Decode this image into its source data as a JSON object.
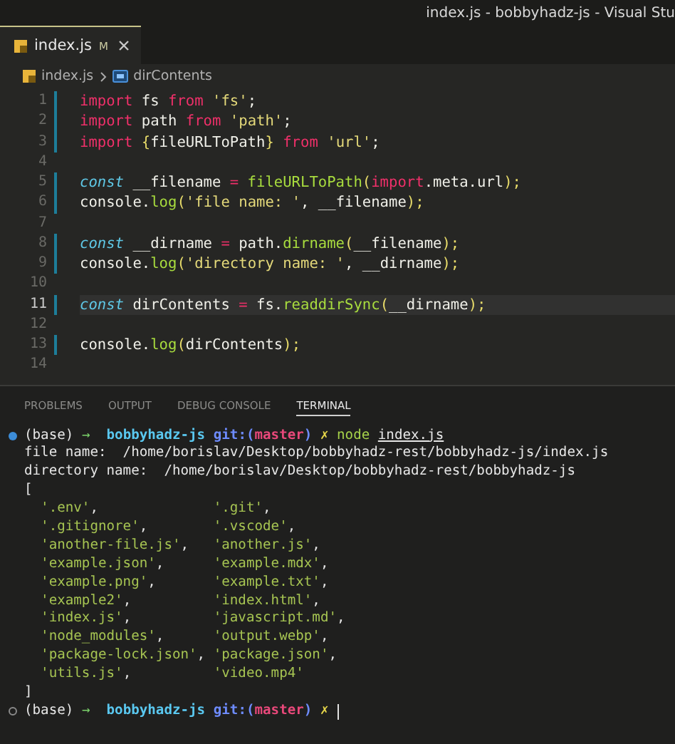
{
  "window": {
    "title": "index.js - bobbyhadz-js - Visual Stu"
  },
  "tabs": [
    {
      "label": "index.js",
      "modified": "M",
      "selected": true
    }
  ],
  "breadcrumb": {
    "file": "index.js",
    "symbol": "dirContents"
  },
  "code_lines": [
    {
      "number": "1",
      "changed": true,
      "current": false,
      "tokens": [
        {
          "text": "import",
          "kind": "keyword"
        },
        {
          "text": " fs ",
          "kind": "plain"
        },
        {
          "text": "from",
          "kind": "keyword"
        },
        {
          "text": " 'fs'",
          "kind": "string"
        },
        {
          "text": ";",
          "kind": "plain"
        }
      ]
    },
    {
      "number": "2",
      "changed": true,
      "current": false,
      "tokens": [
        {
          "text": "import",
          "kind": "keyword"
        },
        {
          "text": " path ",
          "kind": "plain"
        },
        {
          "text": "from",
          "kind": "keyword"
        },
        {
          "text": " 'path'",
          "kind": "string"
        },
        {
          "text": ";",
          "kind": "plain"
        }
      ]
    },
    {
      "number": "3",
      "changed": true,
      "current": false,
      "tokens": [
        {
          "text": "import",
          "kind": "keyword"
        },
        {
          "text": " {",
          "kind": "brace"
        },
        {
          "text": "fileURLToPath",
          "kind": "plain"
        },
        {
          "text": "} ",
          "kind": "brace"
        },
        {
          "text": "from",
          "kind": "keyword"
        },
        {
          "text": " 'url'",
          "kind": "string"
        },
        {
          "text": ";",
          "kind": "plain"
        }
      ]
    },
    {
      "number": "4",
      "changed": false,
      "current": false
    },
    {
      "number": "5",
      "changed": true,
      "current": false,
      "tokens": [
        {
          "text": "const",
          "kind": "storage"
        },
        {
          "text": " __filename ",
          "kind": "plain"
        },
        {
          "text": "=",
          "kind": "keyword"
        },
        {
          "text": " fileURLToPath",
          "kind": "function"
        },
        {
          "text": "(",
          "kind": "brace"
        },
        {
          "text": "import",
          "kind": "keyword"
        },
        {
          "text": ".meta.url",
          "kind": "plain"
        },
        {
          "text": ");",
          "kind": "brace"
        }
      ]
    },
    {
      "number": "6",
      "changed": true,
      "current": false,
      "tokens": [
        {
          "text": "console.",
          "kind": "plain"
        },
        {
          "text": "log",
          "kind": "function"
        },
        {
          "text": "(",
          "kind": "brace"
        },
        {
          "text": "'file name: '",
          "kind": "string"
        },
        {
          "text": ", __filename",
          "kind": "plain"
        },
        {
          "text": ");",
          "kind": "brace"
        }
      ]
    },
    {
      "number": "7",
      "changed": false,
      "current": false
    },
    {
      "number": "8",
      "changed": true,
      "current": false,
      "tokens": [
        {
          "text": "const",
          "kind": "storage"
        },
        {
          "text": " __dirname ",
          "kind": "plain"
        },
        {
          "text": "=",
          "kind": "keyword"
        },
        {
          "text": " path.",
          "kind": "plain"
        },
        {
          "text": "dirname",
          "kind": "function"
        },
        {
          "text": "(",
          "kind": "brace"
        },
        {
          "text": "__filename",
          "kind": "plain"
        },
        {
          "text": ");",
          "kind": "brace"
        }
      ]
    },
    {
      "number": "9",
      "changed": true,
      "current": false,
      "tokens": [
        {
          "text": "console.",
          "kind": "plain"
        },
        {
          "text": "log",
          "kind": "function"
        },
        {
          "text": "(",
          "kind": "brace"
        },
        {
          "text": "'directory name: '",
          "kind": "string"
        },
        {
          "text": ", __dirname",
          "kind": "plain"
        },
        {
          "text": ");",
          "kind": "brace"
        }
      ]
    },
    {
      "number": "10",
      "changed": false,
      "current": false
    },
    {
      "number": "11",
      "changed": true,
      "current": true,
      "tokens": [
        {
          "text": "const",
          "kind": "storage"
        },
        {
          "text": " dirContents ",
          "kind": "plain"
        },
        {
          "text": "=",
          "kind": "keyword"
        },
        {
          "text": " fs.",
          "kind": "plain"
        },
        {
          "text": "readdirSync",
          "kind": "function"
        },
        {
          "text": "(",
          "kind": "brace"
        },
        {
          "text": "__dirname",
          "kind": "plain"
        },
        {
          "text": ");",
          "kind": "brace"
        }
      ]
    },
    {
      "number": "12",
      "changed": false,
      "current": false
    },
    {
      "number": "13",
      "changed": true,
      "current": false,
      "tokens": [
        {
          "text": "console.",
          "kind": "plain"
        },
        {
          "text": "log",
          "kind": "function"
        },
        {
          "text": "(",
          "kind": "brace"
        },
        {
          "text": "dirContents",
          "kind": "plain"
        },
        {
          "text": ");",
          "kind": "brace"
        }
      ]
    },
    {
      "number": "14",
      "changed": false,
      "current": false
    }
  ],
  "panel_tabs": [
    {
      "label": "PROBLEMS",
      "selected": false
    },
    {
      "label": "OUTPUT",
      "selected": false
    },
    {
      "label": "DEBUG CONSOLE",
      "selected": false
    },
    {
      "label": "TERMINAL",
      "selected": true
    }
  ],
  "terminal_lines": [
    {
      "kind": "prompt",
      "succeeded": true,
      "tokens": [
        {
          "text": "(base) ",
          "kind": "plain"
        },
        {
          "text": "→",
          "kind": "arrow"
        },
        {
          "text": "  bobbyhadz-js",
          "kind": "dir"
        },
        {
          "text": " git:(",
          "kind": "git"
        },
        {
          "text": "master",
          "kind": "branch"
        },
        {
          "text": ")",
          "kind": "git"
        },
        {
          "text": " ✗",
          "kind": "dirty"
        },
        {
          "text": " node ",
          "kind": "command"
        },
        {
          "text": "index.js",
          "kind": "argument"
        }
      ]
    },
    {
      "kind": "output",
      "tokens": [
        {
          "text": "file name:  /home/borislav/Desktop/bobbyhadz-rest/bobbyhadz-js/index.js",
          "kind": "plain"
        }
      ]
    },
    {
      "kind": "output",
      "tokens": [
        {
          "text": "directory name:  /home/borislav/Desktop/bobbyhadz-rest/bobbyhadz-js",
          "kind": "plain"
        }
      ]
    },
    {
      "kind": "output",
      "tokens": [
        {
          "text": "[",
          "kind": "plain"
        }
      ]
    },
    {
      "kind": "output",
      "tokens": [
        {
          "text": "  '.env'",
          "kind": "string"
        },
        {
          "text": ",              ",
          "kind": "plain"
        },
        {
          "text": "'.git'",
          "kind": "string"
        },
        {
          "text": ",",
          "kind": "plain"
        }
      ]
    },
    {
      "kind": "output",
      "tokens": [
        {
          "text": "  '.gitignore'",
          "kind": "string"
        },
        {
          "text": ",        ",
          "kind": "plain"
        },
        {
          "text": "'.vscode'",
          "kind": "string"
        },
        {
          "text": ",",
          "kind": "plain"
        }
      ]
    },
    {
      "kind": "output",
      "tokens": [
        {
          "text": "  'another-file.js'",
          "kind": "string"
        },
        {
          "text": ",   ",
          "kind": "plain"
        },
        {
          "text": "'another.js'",
          "kind": "string"
        },
        {
          "text": ",",
          "kind": "plain"
        }
      ]
    },
    {
      "kind": "output",
      "tokens": [
        {
          "text": "  'example.json'",
          "kind": "string"
        },
        {
          "text": ",      ",
          "kind": "plain"
        },
        {
          "text": "'example.mdx'",
          "kind": "string"
        },
        {
          "text": ",",
          "kind": "plain"
        }
      ]
    },
    {
      "kind": "output",
      "tokens": [
        {
          "text": "  'example.png'",
          "kind": "string"
        },
        {
          "text": ",       ",
          "kind": "plain"
        },
        {
          "text": "'example.txt'",
          "kind": "string"
        },
        {
          "text": ",",
          "kind": "plain"
        }
      ]
    },
    {
      "kind": "output",
      "tokens": [
        {
          "text": "  'example2'",
          "kind": "string"
        },
        {
          "text": ",          ",
          "kind": "plain"
        },
        {
          "text": "'index.html'",
          "kind": "string"
        },
        {
          "text": ",",
          "kind": "plain"
        }
      ]
    },
    {
      "kind": "output",
      "tokens": [
        {
          "text": "  'index.js'",
          "kind": "string"
        },
        {
          "text": ",          ",
          "kind": "plain"
        },
        {
          "text": "'javascript.md'",
          "kind": "string"
        },
        {
          "text": ",",
          "kind": "plain"
        }
      ]
    },
    {
      "kind": "output",
      "tokens": [
        {
          "text": "  'node_modules'",
          "kind": "string"
        },
        {
          "text": ",      ",
          "kind": "plain"
        },
        {
          "text": "'output.webp'",
          "kind": "string"
        },
        {
          "text": ",",
          "kind": "plain"
        }
      ]
    },
    {
      "kind": "output",
      "tokens": [
        {
          "text": "  'package-lock.json'",
          "kind": "string"
        },
        {
          "text": ", ",
          "kind": "plain"
        },
        {
          "text": "'package.json'",
          "kind": "string"
        },
        {
          "text": ",",
          "kind": "plain"
        }
      ]
    },
    {
      "kind": "output",
      "tokens": [
        {
          "text": "  'utils.js'",
          "kind": "string"
        },
        {
          "text": ",          ",
          "kind": "plain"
        },
        {
          "text": "'video.mp4'",
          "kind": "string"
        }
      ]
    },
    {
      "kind": "output",
      "tokens": [
        {
          "text": "]",
          "kind": "plain"
        }
      ]
    },
    {
      "kind": "prompt",
      "succeeded": false,
      "cursor": true,
      "tokens": [
        {
          "text": "(base) ",
          "kind": "plain"
        },
        {
          "text": "→",
          "kind": "arrow"
        },
        {
          "text": "  bobbyhadz-js",
          "kind": "dir"
        },
        {
          "text": " git:(",
          "kind": "git"
        },
        {
          "text": "master",
          "kind": "branch"
        },
        {
          "text": ")",
          "kind": "git"
        },
        {
          "text": " ✗",
          "kind": "dirty"
        }
      ]
    }
  ]
}
